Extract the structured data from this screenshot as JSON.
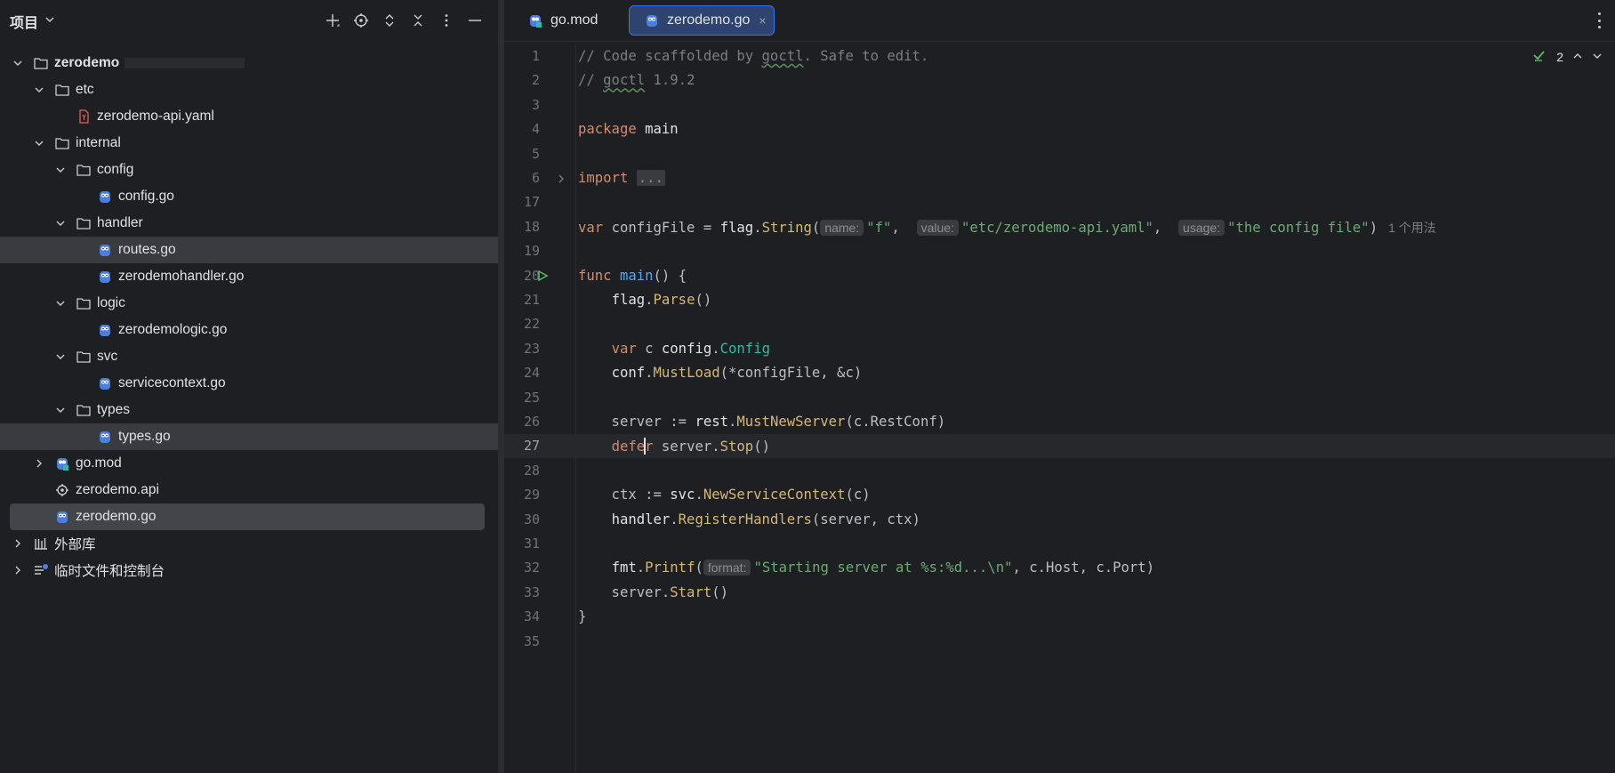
{
  "project_panel": {
    "title": "项目",
    "toolbar": [
      "add-icon",
      "locate-icon",
      "expand-all-icon",
      "collapse-all-icon",
      "more-icon",
      "hide-icon"
    ],
    "tree": [
      {
        "label": "zerodemo",
        "depth": 0,
        "expanded": true,
        "kind": "folder",
        "bold": true
      },
      {
        "label": "etc",
        "depth": 1,
        "expanded": true,
        "kind": "folder"
      },
      {
        "label": "zerodemo-api.yaml",
        "depth": 2,
        "kind": "yaml"
      },
      {
        "label": "internal",
        "depth": 1,
        "expanded": true,
        "kind": "folder"
      },
      {
        "label": "config",
        "depth": 2,
        "expanded": true,
        "kind": "folder"
      },
      {
        "label": "config.go",
        "depth": 3,
        "kind": "go"
      },
      {
        "label": "handler",
        "depth": 2,
        "expanded": true,
        "kind": "folder"
      },
      {
        "label": "routes.go",
        "depth": 3,
        "kind": "go",
        "highlight": true
      },
      {
        "label": "zerodemohandler.go",
        "depth": 3,
        "kind": "go"
      },
      {
        "label": "logic",
        "depth": 2,
        "expanded": true,
        "kind": "folder"
      },
      {
        "label": "zerodemologic.go",
        "depth": 3,
        "kind": "go"
      },
      {
        "label": "svc",
        "depth": 2,
        "expanded": true,
        "kind": "folder"
      },
      {
        "label": "servicecontext.go",
        "depth": 3,
        "kind": "go"
      },
      {
        "label": "types",
        "depth": 2,
        "expanded": true,
        "kind": "folder"
      },
      {
        "label": "types.go",
        "depth": 3,
        "kind": "go",
        "highlight": true
      },
      {
        "label": "go.mod",
        "depth": 1,
        "expanded": false,
        "kind": "gomod"
      },
      {
        "label": "zerodemo.api",
        "depth": 1,
        "kind": "api"
      },
      {
        "label": "zerodemo.go",
        "depth": 1,
        "kind": "go",
        "selected": true
      },
      {
        "label": "外部库",
        "depth": 0,
        "expanded": false,
        "kind": "library"
      },
      {
        "label": "临时文件和控制台",
        "depth": 0,
        "expanded": false,
        "kind": "scratch"
      }
    ]
  },
  "tabs": [
    {
      "label": "go.mod",
      "active": false
    },
    {
      "label": "zerodemo.go",
      "active": true,
      "close": "×"
    }
  ],
  "inspection": {
    "count": "2"
  },
  "code": {
    "lines": [
      {
        "n": "1",
        "parts": [
          [
            "cm",
            "// Code scaffolded by "
          ],
          [
            "cm squig",
            "goctl"
          ],
          [
            "cm",
            ". Safe to edit."
          ]
        ]
      },
      {
        "n": "2",
        "parts": [
          [
            "cm",
            "// "
          ],
          [
            "cm squig",
            "goctl"
          ],
          [
            "cm",
            " 1.9.2"
          ]
        ]
      },
      {
        "n": "3",
        "parts": []
      },
      {
        "n": "4",
        "parts": [
          [
            "kw",
            "package "
          ],
          [
            "pk",
            "main"
          ]
        ]
      },
      {
        "n": "5",
        "parts": []
      },
      {
        "n": "6",
        "parts": [
          [
            "kw",
            "import "
          ],
          [
            "fold",
            "..."
          ]
        ],
        "fold": true
      },
      {
        "n": "17",
        "parts": []
      },
      {
        "n": "18",
        "parts": [
          [
            "kw",
            "var "
          ],
          [
            "pl",
            "configFile = "
          ],
          [
            "pk",
            "flag"
          ],
          [
            "pl",
            "."
          ],
          [
            "mt",
            "String"
          ],
          [
            "pl",
            "("
          ],
          [
            "hint",
            "name:"
          ],
          [
            "st",
            "\"f\""
          ],
          [
            "pl",
            ",  "
          ],
          [
            "hint",
            "value:"
          ],
          [
            "st",
            "\"etc/zerodemo-api.yaml\""
          ],
          [
            "pl",
            ",  "
          ],
          [
            "hint",
            "usage:"
          ],
          [
            "st",
            "\"the config file\""
          ],
          [
            "pl",
            ")"
          ],
          [
            "usage",
            "1 个用法"
          ]
        ]
      },
      {
        "n": "19",
        "parts": []
      },
      {
        "n": "20",
        "parts": [
          [
            "kw",
            "func "
          ],
          [
            "fn",
            "main"
          ],
          [
            "pl",
            "() {"
          ]
        ],
        "run": true
      },
      {
        "n": "21",
        "parts": [
          [
            "pl",
            "    "
          ],
          [
            "pk",
            "flag"
          ],
          [
            "pl",
            "."
          ],
          [
            "mt",
            "Parse"
          ],
          [
            "pl",
            "()"
          ]
        ]
      },
      {
        "n": "22",
        "parts": []
      },
      {
        "n": "23",
        "parts": [
          [
            "pl",
            "    "
          ],
          [
            "kw",
            "var "
          ],
          [
            "pl",
            "c "
          ],
          [
            "pk",
            "config"
          ],
          [
            "pl",
            "."
          ],
          [
            "ty",
            "Config"
          ]
        ]
      },
      {
        "n": "24",
        "parts": [
          [
            "pl",
            "    "
          ],
          [
            "pk",
            "conf"
          ],
          [
            "pl",
            "."
          ],
          [
            "mt",
            "MustLoad"
          ],
          [
            "pl",
            "(*configFile, &c)"
          ]
        ]
      },
      {
        "n": "25",
        "parts": []
      },
      {
        "n": "26",
        "parts": [
          [
            "pl",
            "    server := "
          ],
          [
            "pk",
            "rest"
          ],
          [
            "pl",
            "."
          ],
          [
            "mt",
            "MustNewServer"
          ],
          [
            "pl",
            "(c.RestConf)"
          ]
        ]
      },
      {
        "n": "27",
        "parts": [
          [
            "pl",
            "    "
          ],
          [
            "kw",
            "defe"
          ],
          [
            "caret",
            ""
          ],
          [
            "kw",
            "r "
          ],
          [
            "pl",
            "server."
          ],
          [
            "mt",
            "Stop"
          ],
          [
            "pl",
            "()"
          ]
        ],
        "current": true
      },
      {
        "n": "28",
        "parts": []
      },
      {
        "n": "29",
        "parts": [
          [
            "pl",
            "    ctx := "
          ],
          [
            "pk",
            "svc"
          ],
          [
            "pl",
            "."
          ],
          [
            "mt",
            "NewServiceContext"
          ],
          [
            "pl",
            "(c)"
          ]
        ]
      },
      {
        "n": "30",
        "parts": [
          [
            "pl",
            "    "
          ],
          [
            "pk",
            "handler"
          ],
          [
            "pl",
            "."
          ],
          [
            "mt",
            "RegisterHandlers"
          ],
          [
            "pl",
            "(server, ctx)"
          ]
        ]
      },
      {
        "n": "31",
        "parts": []
      },
      {
        "n": "32",
        "parts": [
          [
            "pl",
            "    "
          ],
          [
            "pk",
            "fmt"
          ],
          [
            "pl",
            "."
          ],
          [
            "mt",
            "Printf"
          ],
          [
            "pl",
            "("
          ],
          [
            "hint",
            "format:"
          ],
          [
            "st",
            "\"Starting server at %s:%d...\\n\""
          ],
          [
            "pl",
            ", c.Host, c.Port)"
          ]
        ]
      },
      {
        "n": "33",
        "parts": [
          [
            "pl",
            "    server."
          ],
          [
            "mt",
            "Start"
          ],
          [
            "pl",
            "()"
          ]
        ]
      },
      {
        "n": "34",
        "parts": [
          [
            "pl",
            "}"
          ]
        ]
      },
      {
        "n": "35",
        "parts": []
      }
    ]
  }
}
